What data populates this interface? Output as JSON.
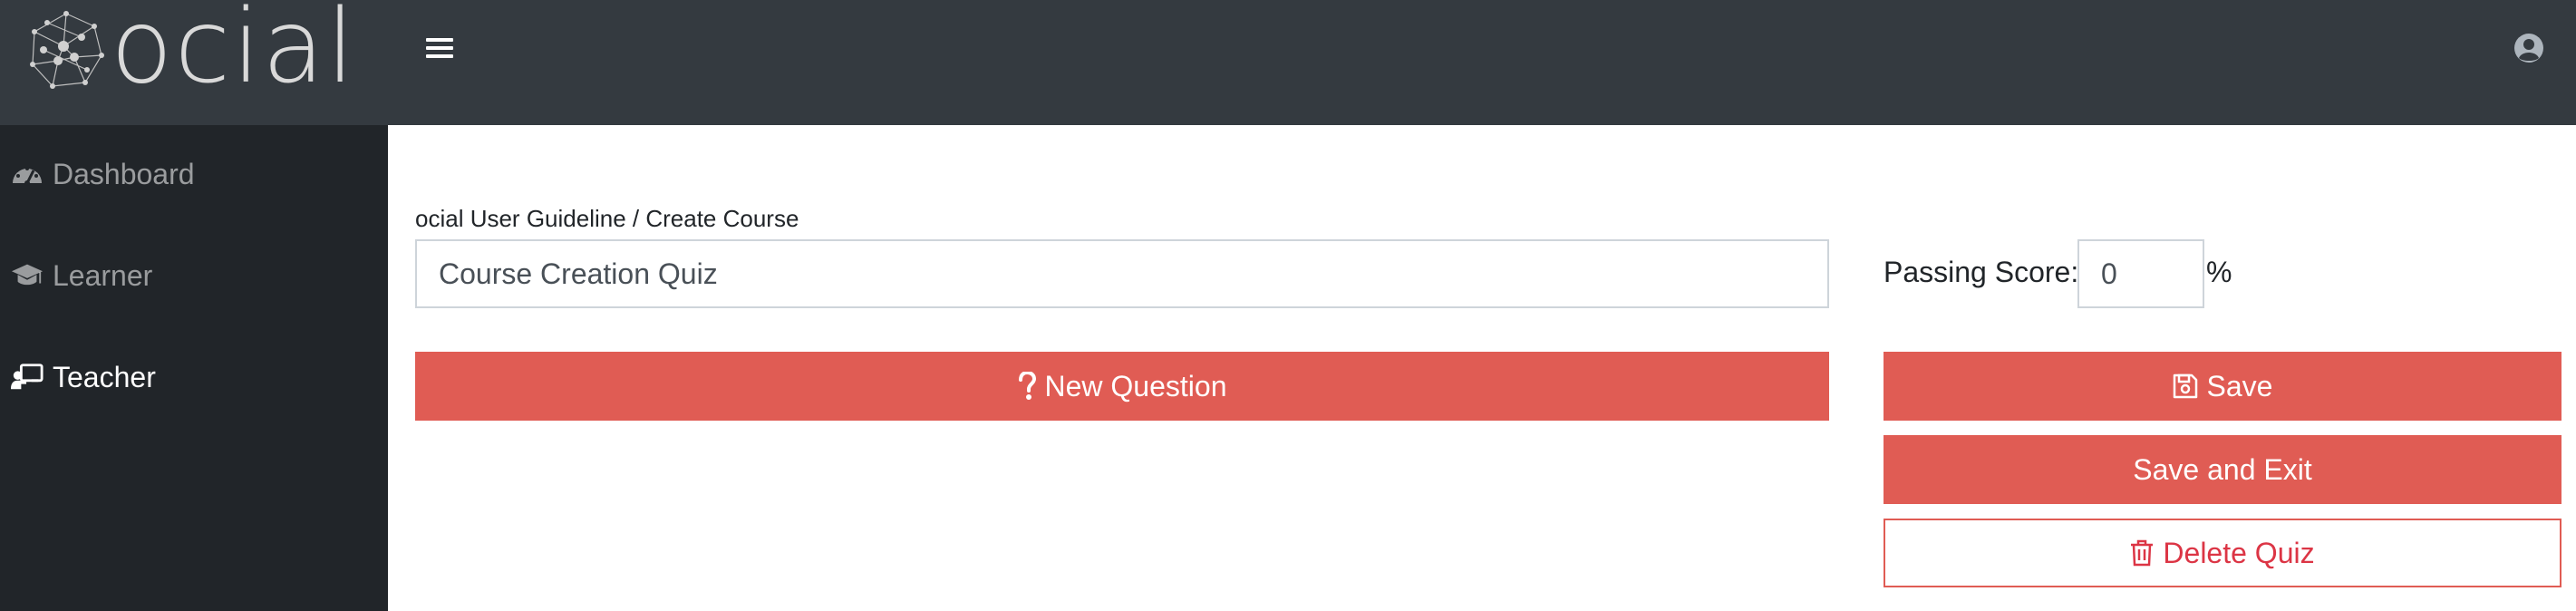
{
  "brand": {
    "logo_text": "ocial"
  },
  "header": {
    "menu_icon": "hamburger-icon",
    "user_icon": "user-circle-icon"
  },
  "sidebar": {
    "items": [
      {
        "label": "Dashboard",
        "icon": "tachometer-icon",
        "active": false
      },
      {
        "label": "Learner",
        "icon": "graduation-cap-icon",
        "active": false
      },
      {
        "label": "Teacher",
        "icon": "chalkboard-teacher-icon",
        "active": true
      }
    ]
  },
  "main": {
    "breadcrumb": "ocial User Guideline / Create Course",
    "quiz_title_value": "Course Creation Quiz",
    "passing_score_label": "Passing Score:",
    "passing_score_value": "0",
    "percent_sign": "%",
    "buttons": {
      "new_question": "New Question",
      "save": "Save",
      "save_and_exit": "Save and Exit",
      "delete_quiz": "Delete Quiz"
    }
  },
  "colors": {
    "topbar": "#343a40",
    "sidebar": "#212529",
    "accent": "#e05c54",
    "danger_text": "#dc3545"
  }
}
